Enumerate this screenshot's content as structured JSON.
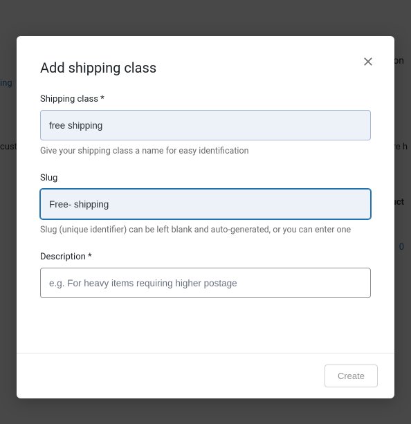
{
  "background": {
    "partial_right_top": "on",
    "link_left": "ing",
    "cust_left": "cust",
    "ire_right": "ire h",
    "col_right": "uct",
    "zero_right": "0"
  },
  "modal": {
    "title": "Add shipping class",
    "close_icon": "close-icon",
    "fields": {
      "name": {
        "label": "Shipping class *",
        "value": "free shipping",
        "help": "Give your shipping class a name for easy identification"
      },
      "slug": {
        "label": "Slug",
        "value": "Free- shipping",
        "help": "Slug (unique identifier) can be left blank and auto-generated, or you can enter one"
      },
      "description": {
        "label": "Description *",
        "placeholder": "e.g. For heavy items requiring higher postage"
      }
    },
    "footer": {
      "create_label": "Create"
    }
  }
}
